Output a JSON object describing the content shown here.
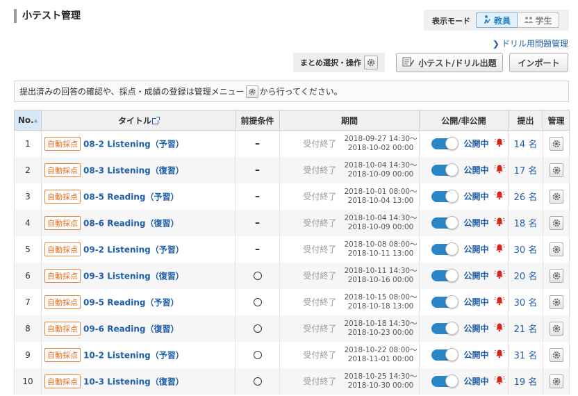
{
  "page": {
    "title": "小テスト管理"
  },
  "mode": {
    "label": "表示モード",
    "teacher": "教員",
    "student": "学生"
  },
  "links": {
    "drill": "ドリル用問題管理"
  },
  "toolbar": {
    "bulk_label": "まとめ選択・操作",
    "quiz_button": "小テスト/ドリル出題",
    "import_button": "インポート"
  },
  "notice": {
    "before": "提出済みの回答の確認や、採点・成績の登録は管理メニュー",
    "after": "から行ってください。"
  },
  "table": {
    "headers": {
      "no": "No.",
      "title": "タイトル",
      "prereq": "前提条件",
      "period": "期間",
      "publish": "公開/非公開",
      "submit": "提出",
      "manage": "管理"
    },
    "rows": [
      {
        "no": "1",
        "badge": "自動採点",
        "title": "08-2 Listening（予習）",
        "prereq": "–",
        "status": "受付終了",
        "start": "2018-09-27 14:30～",
        "end": "2018-10-02 00:00",
        "publish": "公開中",
        "submit": "14 名"
      },
      {
        "no": "2",
        "badge": "自動採点",
        "title": "08-3 Listening（復習）",
        "prereq": "–",
        "status": "受付終了",
        "start": "2018-10-04 14:30～",
        "end": "2018-10-09 00:00",
        "publish": "公開中",
        "submit": "17 名"
      },
      {
        "no": "3",
        "badge": "自動採点",
        "title": "08-5 Reading（予習）",
        "prereq": "–",
        "status": "受付終了",
        "start": "2018-10-01 08:00～",
        "end": "2018-10-04 13:00",
        "publish": "公開中",
        "submit": "26 名"
      },
      {
        "no": "4",
        "badge": "自動採点",
        "title": "08-6 Reading（復習）",
        "prereq": "–",
        "status": "受付終了",
        "start": "2018-10-04 14:30～",
        "end": "2018-10-09 00:00",
        "publish": "公開中",
        "submit": "18 名"
      },
      {
        "no": "5",
        "badge": "自動採点",
        "title": "09-2 Listening（予習）",
        "prereq": "–",
        "status": "受付終了",
        "start": "2018-10-08 08:00～",
        "end": "2018-10-11 13:00",
        "publish": "公開中",
        "submit": "30 名"
      },
      {
        "no": "6",
        "badge": "自動採点",
        "title": "09-3 Listening（復習）",
        "prereq": "○",
        "status": "受付終了",
        "start": "2018-10-11 14:30～",
        "end": "2018-10-16 00:00",
        "publish": "公開中",
        "submit": "20 名"
      },
      {
        "no": "7",
        "badge": "自動採点",
        "title": "09-5 Reading（予習）",
        "prereq": "○",
        "status": "受付終了",
        "start": "2018-10-15 08:00～",
        "end": "2018-10-18 13:00",
        "publish": "公開中",
        "submit": "30 名"
      },
      {
        "no": "8",
        "badge": "自動採点",
        "title": "09-6 Reading（復習）",
        "prereq": "○",
        "status": "受付終了",
        "start": "2018-10-18 14:30～",
        "end": "2018-10-23 00:00",
        "publish": "公開中",
        "submit": "21 名"
      },
      {
        "no": "9",
        "badge": "自動採点",
        "title": "10-2 Listening（予習）",
        "prereq": "○",
        "status": "受付終了",
        "start": "2018-10-22 08:00～",
        "end": "2018-11-01 00:00",
        "publish": "公開中",
        "submit": "31 名"
      },
      {
        "no": "10",
        "badge": "自動採点",
        "title": "10-3 Listening（復習）",
        "prereq": "○",
        "status": "受付終了",
        "start": "2018-10-25 14:30～",
        "end": "2018-10-30 00:00",
        "publish": "公開中",
        "submit": "19 名"
      }
    ]
  },
  "colors": {
    "accent": "#2a86c9",
    "link": "#1f5ea8",
    "badge": "#e06b1e",
    "bell": "#d9261c"
  }
}
